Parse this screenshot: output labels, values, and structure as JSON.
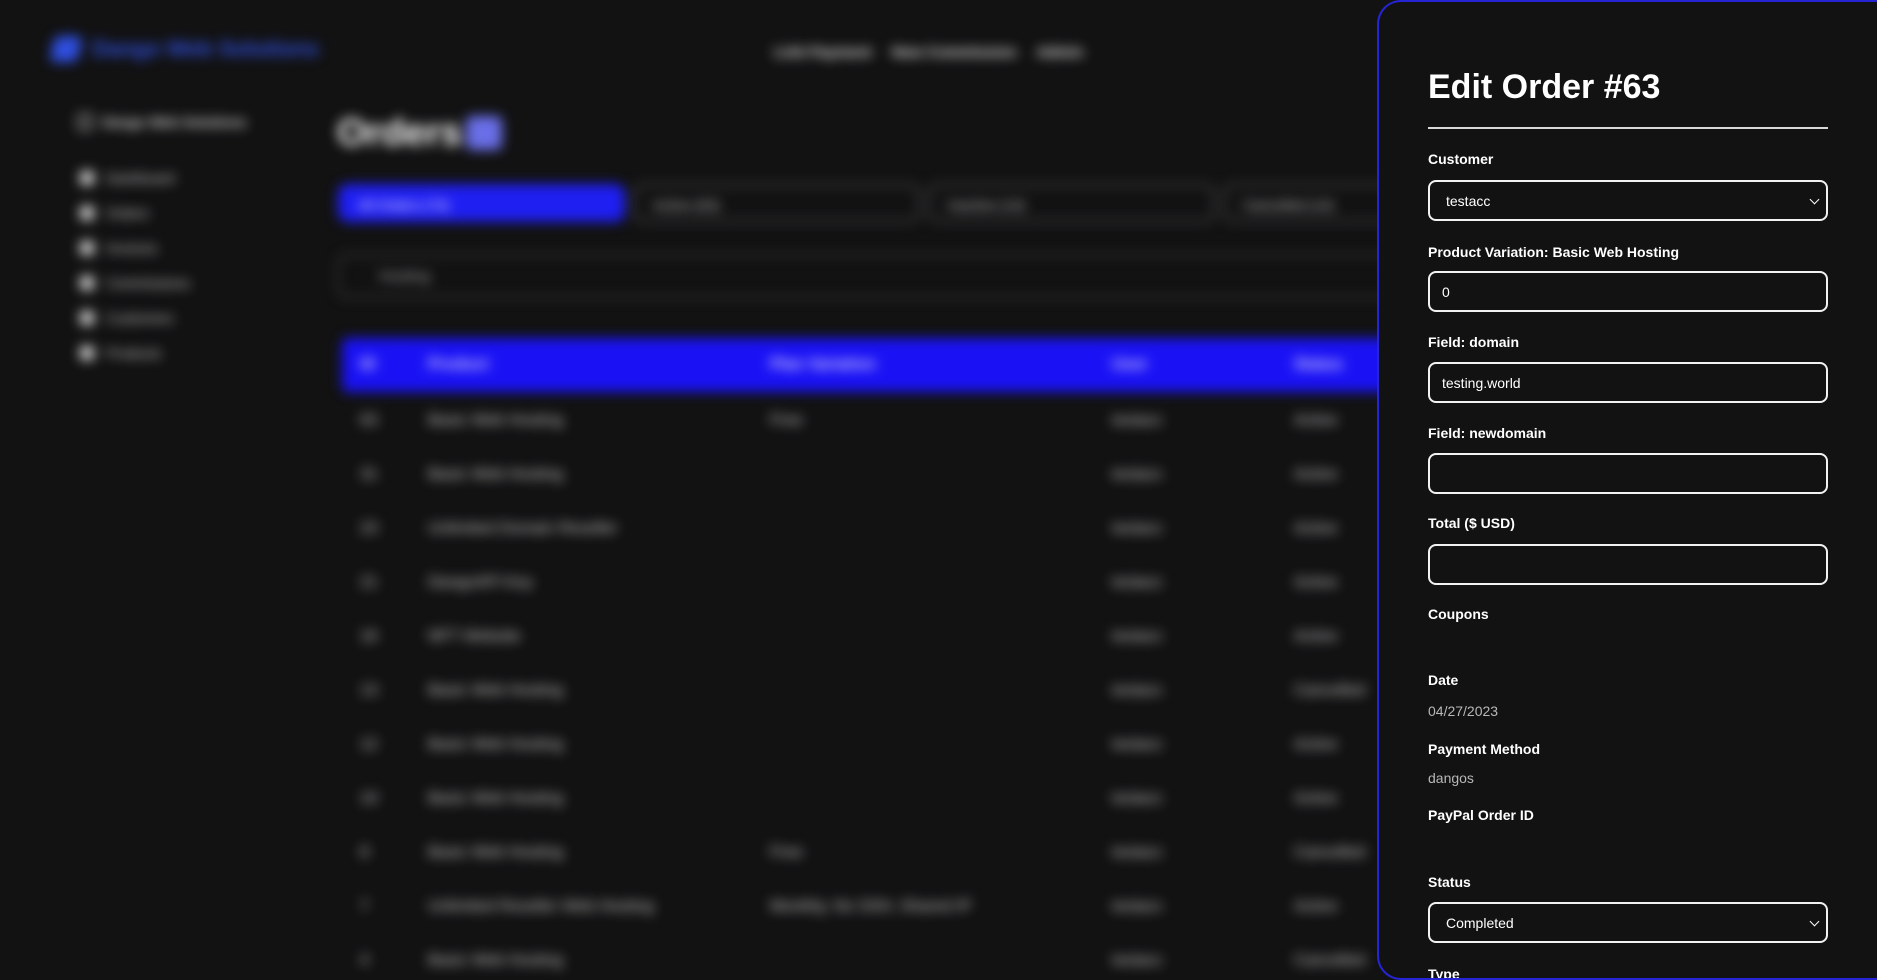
{
  "app": {
    "brand": "Dango Web Solutions",
    "topnav": [
      "Link Payment",
      "New Commission",
      "Admin"
    ]
  },
  "sidebar": {
    "company": "Dango Web Solutions",
    "items": [
      "Dashboard",
      "Orders",
      "Invoices",
      "Commissions",
      "Customers",
      "Products"
    ]
  },
  "orders": {
    "title": "Orders",
    "tabs": [
      "All Orders (74)",
      "Active (63)",
      "Inactive (14)",
      "Cancelled (14)"
    ],
    "search_value": "Hosting",
    "columns": [
      "ID",
      "Product",
      "Plan Variation",
      "User",
      "Status"
    ],
    "rows": [
      [
        "63",
        "Basic Web Hosting",
        "Free",
        "testacc",
        "Active"
      ],
      [
        "31",
        "Basic Web Hosting",
        "",
        "testacc",
        "Active"
      ],
      [
        "23",
        "Unlimited Domain Reseller",
        "",
        "testacc",
        "Active"
      ],
      [
        "21",
        "DangoAPI Key",
        "",
        "testacc",
        "Active"
      ],
      [
        "16",
        "NFT Website",
        "",
        "testacc",
        "Active"
      ],
      [
        "13",
        "Basic Web Hosting",
        "",
        "testacc",
        "Cancelled"
      ],
      [
        "12",
        "Basic Web Hosting",
        "",
        "testacc",
        "Active"
      ],
      [
        "10",
        "Basic Web Hosting",
        "",
        "testacc",
        "Active"
      ],
      [
        "8",
        "Basic Web Hosting",
        "Free",
        "testacc",
        "Cancelled"
      ],
      [
        "7",
        "Unlimited Reseller Web Hosting",
        "Monthly, No SSH, Shared IP",
        "testacc",
        "Active"
      ],
      [
        "4",
        "Basic Web Hosting",
        "",
        "testacc",
        "Cancelled"
      ]
    ]
  },
  "panel": {
    "title": "Edit Order #63",
    "customer_label": "Customer",
    "customer_value": "testacc",
    "product_variation_label": "Product Variation: Basic Web Hosting",
    "product_variation_value": "0",
    "domain_label": "Field: domain",
    "domain_value": "testing.world",
    "newdomain_label": "Field: newdomain",
    "newdomain_value": "",
    "total_label": "Total ($ USD)",
    "total_value": "",
    "coupons_label": "Coupons",
    "date_label": "Date",
    "date_value": "04/27/2023",
    "payment_method_label": "Payment Method",
    "payment_method_value": "dangos",
    "paypal_label": "PayPal Order ID",
    "status_label": "Status",
    "status_value": "Completed",
    "type_label": "Type"
  },
  "colors": {
    "accent": "#1f1ff2",
    "panel_border": "#2525d6",
    "background": "#121213"
  }
}
